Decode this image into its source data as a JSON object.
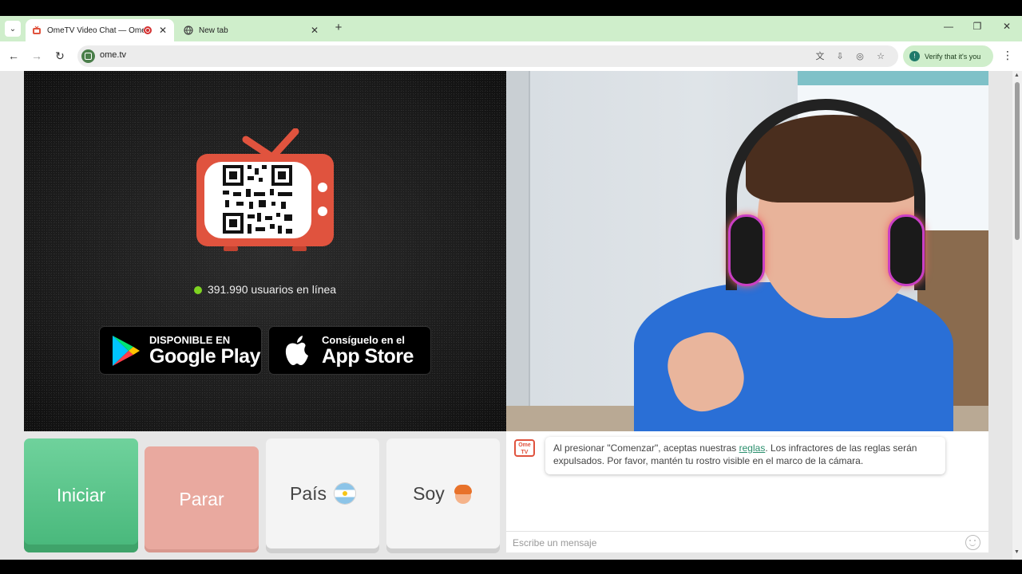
{
  "browser": {
    "tabs": [
      {
        "title": "OmeTV Video Chat — Ome",
        "active": true
      },
      {
        "title": "New tab",
        "active": false
      }
    ],
    "new_tab_symbol": "+",
    "url": "ome.tv",
    "verify_label": "Verify that it's you",
    "window_controls": {
      "minimize": "—",
      "restore": "❐",
      "close": "✕"
    }
  },
  "stranger_panel": {
    "online_count_text": "391.990 usuarios en línea",
    "google_play": {
      "small": "DISPONIBLE EN",
      "big": "Google Play"
    },
    "app_store": {
      "small": "Consíguelo en el",
      "big": "App Store"
    }
  },
  "controls": {
    "start_label": "Iniciar",
    "stop_label": "Parar",
    "country_label": "País",
    "country_icon": "argentina-flag-icon",
    "gender_label": "Soy",
    "gender_icon": "boy-icon"
  },
  "chat": {
    "logo_text": "Ome TV",
    "notice_before": "Al presionar \"Comenzar\", aceptas nuestras ",
    "notice_link": "reglas",
    "notice_after": ". Los infractores de las reglas serán expulsados. Por favor, mantén tu rostro visible en el marco de la cámara.",
    "input_placeholder": "Escribe un mensaje"
  },
  "colors": {
    "tabstrip": "#cfeecb",
    "start_green": "#47b77a",
    "stop_red": "#e9a99f",
    "brand_orange": "#e0533e",
    "online_dot": "#7ed321",
    "link": "#2a8f6d"
  }
}
